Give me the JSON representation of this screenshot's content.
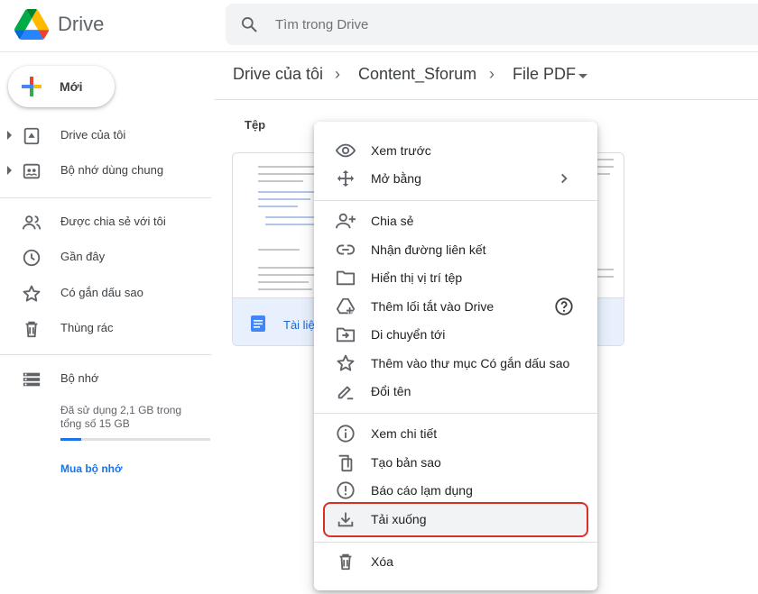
{
  "app": {
    "title": "Drive"
  },
  "search": {
    "placeholder": "Tìm trong Drive"
  },
  "sidebar": {
    "new_label": "Mới",
    "items": [
      {
        "label": "Drive của tôi",
        "icon": "my-drive-icon"
      },
      {
        "label": "Bộ nhớ dùng chung",
        "icon": "shared-drives-icon"
      },
      {
        "label": "Được chia sẻ với tôi",
        "icon": "shared-with-me-icon"
      },
      {
        "label": "Gần đây",
        "icon": "clock-icon"
      },
      {
        "label": "Có gắn dấu sao",
        "icon": "star-icon"
      },
      {
        "label": "Thùng rác",
        "icon": "trash-icon"
      }
    ],
    "storage": {
      "label": "Bộ nhớ",
      "usage_text": "Đã sử dụng 2,1 GB trong tổng số 15 GB",
      "used_fraction": 0.14,
      "buy_label": "Mua bộ nhớ"
    }
  },
  "breadcrumb": {
    "items": [
      "Drive của tôi",
      "Content_Sforum",
      "File PDF"
    ],
    "separator": "›"
  },
  "main": {
    "section_label": "Tệp",
    "file_card": {
      "name": "Tài liệ",
      "icon": "google-docs-icon"
    }
  },
  "context_menu": {
    "items": [
      {
        "label": "Xem trước",
        "icon": "eye-icon"
      },
      {
        "label": "Mở bằng",
        "icon": "open-with-icon",
        "submenu": true
      },
      {
        "label": "Chia sẻ",
        "icon": "person-add-icon"
      },
      {
        "label": "Nhận đường liên kết",
        "icon": "link-icon"
      },
      {
        "label": "Hiển thị vị trí tệp",
        "icon": "folder-icon"
      },
      {
        "label": "Thêm lối tắt vào Drive",
        "icon": "add-shortcut-icon",
        "help": true
      },
      {
        "label": "Di chuyển tới",
        "icon": "move-to-icon"
      },
      {
        "label": "Thêm vào thư mục Có gắn dấu sao",
        "icon": "star-outline-icon"
      },
      {
        "label": "Đổi tên",
        "icon": "rename-icon"
      },
      {
        "label": "Xem chi tiết",
        "icon": "info-icon"
      },
      {
        "label": "Tạo bản sao",
        "icon": "copy-icon"
      },
      {
        "label": "Báo cáo lạm dụng",
        "icon": "report-icon"
      },
      {
        "label": "Tải xuống",
        "icon": "download-icon",
        "highlighted": true
      },
      {
        "label": "Xóa",
        "icon": "trash-icon"
      }
    ]
  },
  "colors": {
    "accent": "#1a73e8",
    "highlight_border": "#d93025",
    "text": "#3c4043"
  }
}
